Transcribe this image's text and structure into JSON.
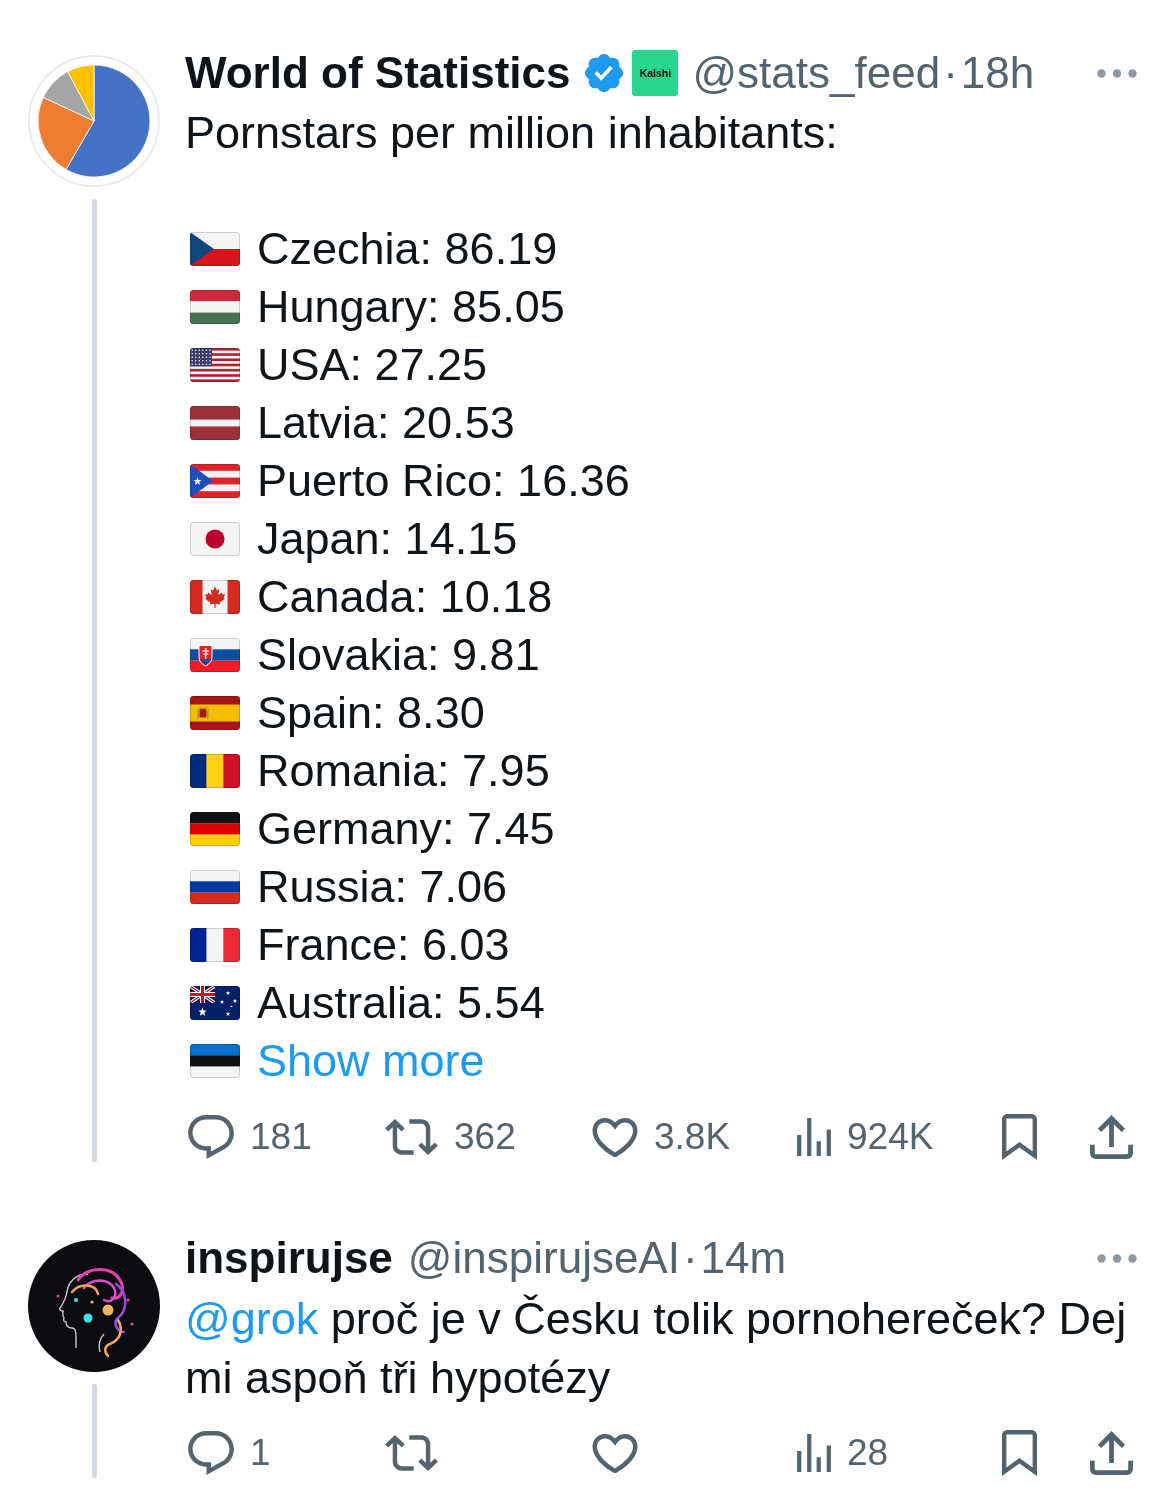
{
  "tweets": [
    {
      "author": {
        "name": "World of Statistics",
        "verified": true,
        "affiliate": "Kalshi",
        "handle": "@stats_feed",
        "separator": "·",
        "time": "18h"
      },
      "avatar": {
        "kind": "pie"
      },
      "intro": "Pornstars per million inhabitants:",
      "list": [
        {
          "kind": "cz",
          "text": "Czechia: 86.19"
        },
        {
          "kind": "hu",
          "text": "Hungary: 85.05"
        },
        {
          "kind": "us",
          "text": "USA: 27.25"
        },
        {
          "kind": "lv",
          "text": "Latvia: 20.53"
        },
        {
          "kind": "pr",
          "text": "Puerto Rico: 16.36"
        },
        {
          "kind": "jp",
          "text": "Japan: 14.15"
        },
        {
          "kind": "ca",
          "text": "Canada: 10.18"
        },
        {
          "kind": "sk",
          "text": "Slovakia: 9.81"
        },
        {
          "kind": "es",
          "text": "Spain: 8.30"
        },
        {
          "kind": "ro",
          "text": "Romania: 7.95"
        },
        {
          "kind": "de",
          "text": "Germany: 7.45"
        },
        {
          "kind": "ru",
          "text": "Russia: 7.06"
        },
        {
          "kind": "fr",
          "text": "France: 6.03"
        },
        {
          "kind": "au",
          "text": "Australia: 5.54"
        }
      ],
      "show_more": {
        "kind": "ee",
        "label": "Show more"
      },
      "actions": [
        {
          "kind": "reply",
          "count": "181"
        },
        {
          "kind": "repost",
          "count": "362"
        },
        {
          "kind": "like",
          "count": "3.8K"
        },
        {
          "kind": "views",
          "count": "924K"
        },
        {
          "kind": "bookmark"
        },
        {
          "kind": "share"
        }
      ]
    },
    {
      "author": {
        "name": "inspirujse",
        "handle": "@inspirujseAI",
        "separator": "·",
        "time": "14m"
      },
      "avatar": {
        "kind": "head"
      },
      "text": [
        {
          "kind": "mention",
          "text": "@grok"
        },
        {
          "kind": "plain",
          "text": " proč je v Česku tolik pornohereček? Dej mi aspoň tři hypotézy"
        }
      ],
      "actions": [
        {
          "kind": "reply",
          "count": "1"
        },
        {
          "kind": "repost"
        },
        {
          "kind": "like"
        },
        {
          "kind": "views",
          "count": "28"
        },
        {
          "kind": "bookmark"
        },
        {
          "kind": "share"
        }
      ]
    }
  ]
}
